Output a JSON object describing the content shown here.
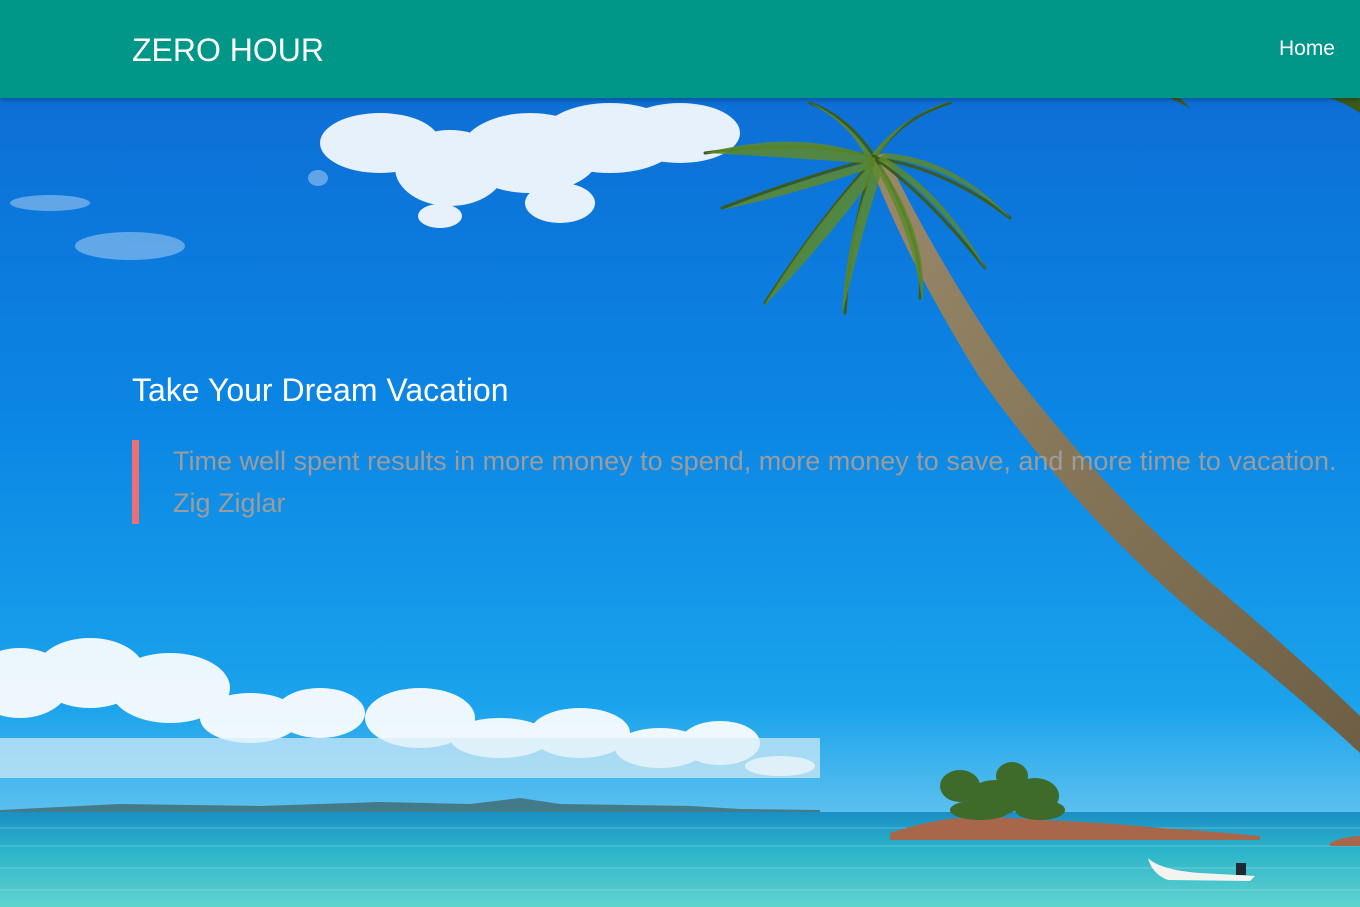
{
  "navbar": {
    "brand": "ZERO HOUR",
    "links": [
      {
        "label": "Home"
      }
    ],
    "color": "#009688"
  },
  "hero": {
    "title": "Take Your Dream Vacation",
    "quote": {
      "text": "Time well spent results in more money to spend, more money to save, and more time to vacation.",
      "author": "Zig Ziglar",
      "accent_color": "#ee6e73"
    },
    "background_scene": "tropical-beach-palm-tree"
  }
}
